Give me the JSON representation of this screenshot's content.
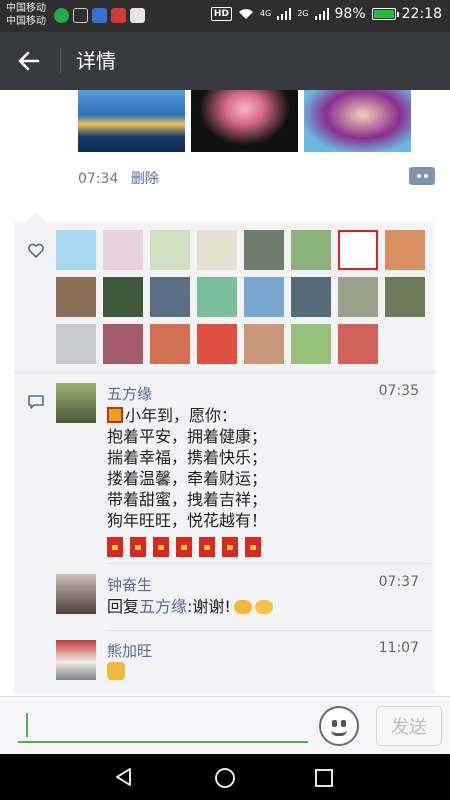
{
  "status_bar": {
    "carrier_1": "中国移动",
    "carrier_2": "中国移动",
    "hd": "HD",
    "net_1": "4G",
    "net_2": "2G",
    "battery": "98%",
    "time": "22:18"
  },
  "header": {
    "title": "详情"
  },
  "post": {
    "time": "07:34",
    "delete_label": "删除"
  },
  "likes": {
    "count": 23
  },
  "comments": [
    {
      "name": "五方缘",
      "time": "07:35",
      "text": "小年到，愿你：\n抱着平安，拥着健康；\n揣着幸福，携着快乐；\n搂着温馨，牵着财运；\n带着甜蜜，拽着吉祥；\n狗年旺旺，悦花越有！",
      "red_envelopes": 7
    },
    {
      "name": "钟奋生",
      "time": "07:37",
      "reply_prefix": "回复",
      "reply_to": "五方缘",
      "reply_text": ":谢谢!"
    },
    {
      "name": "熊加旺",
      "time": "11:07"
    }
  ],
  "input": {
    "placeholder": "",
    "value": ""
  },
  "send_label": "发送",
  "icons": [
    "back-arrow-icon",
    "heart-icon",
    "comment-icon",
    "emoji-icon",
    "nav-back-icon",
    "nav-home-icon",
    "nav-recents-icon"
  ],
  "colors": {
    "link": "#576b95",
    "titlebar": "#393a3f",
    "accent": "#4caf50"
  }
}
